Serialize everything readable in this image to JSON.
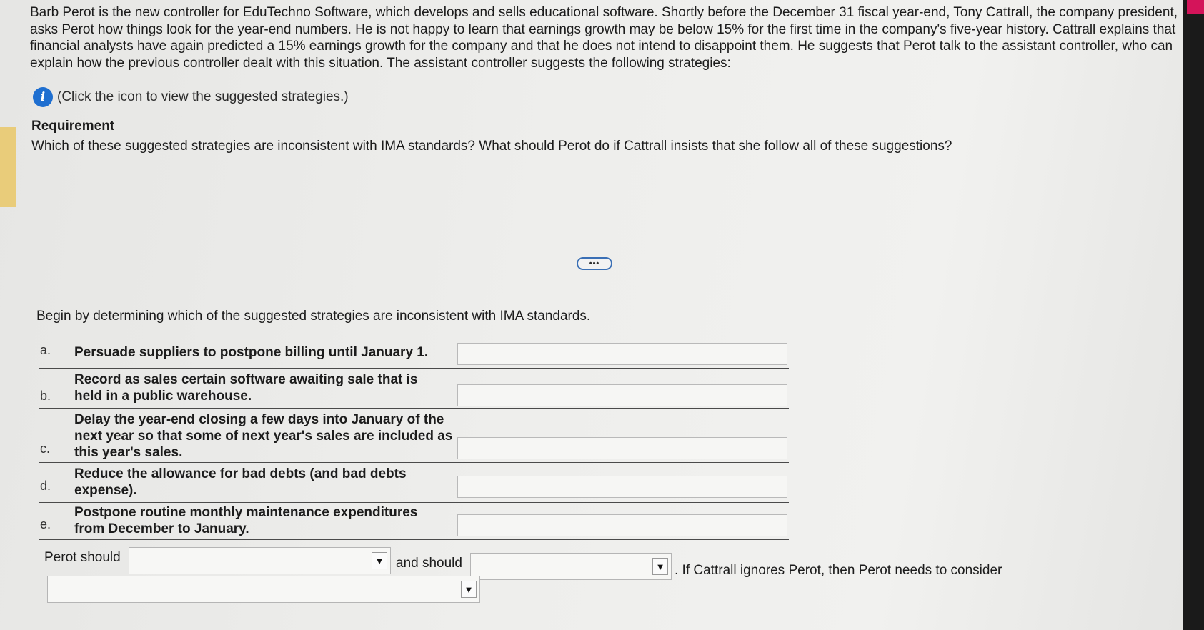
{
  "intro": {
    "paragraph": "Barb Perot is the new controller for EduTechno Software, which develops and sells educational software. Shortly before the December 31 fiscal year-end, Tony Cattrall, the company president, asks Perot how things look for the year-end numbers. He is not happy to learn that earnings growth may be below 15% for the first time in the company's five-year history. Cattrall explains that financial analysts have again predicted a 15% earnings growth for the company and that he does not intend to disappoint them. He suggests that Perot talk to the assistant controller, who can explain how the previous controller dealt with this situation. The assistant controller suggests the following strategies:"
  },
  "info": {
    "icon": "info-icon",
    "icon_glyph": "i",
    "text": "(Click the icon to view the suggested strategies.)"
  },
  "requirement": {
    "title": "Requirement",
    "text": "Which of these suggested strategies are inconsistent with IMA standards? What should Perot do if Cattrall insists that she follow all of these suggestions?"
  },
  "more_button": {
    "label": "•••"
  },
  "task": {
    "instruction": "Begin by determining which of the suggested strategies are inconsistent with IMA standards.",
    "strategies": [
      {
        "letter": "a.",
        "text": "Persuade suppliers to postpone billing until January 1.",
        "answer": ""
      },
      {
        "letter": "b.",
        "text": "Record as sales certain software awaiting sale that is held in a public warehouse.",
        "answer": ""
      },
      {
        "letter": "c.",
        "text": "Delay the year-end closing a few days into January of the next year so that some of next year's sales are included as this year's sales.",
        "answer": ""
      },
      {
        "letter": "d.",
        "text": "Reduce the allowance for bad debts (and bad debts expense).",
        "answer": ""
      },
      {
        "letter": "e.",
        "text": "Postpone routine monthly maintenance expenditures from December to January.",
        "answer": ""
      }
    ]
  },
  "perot": {
    "label_should": "Perot should",
    "label_and_should": "and should",
    "label_if_ignores": ". If Cattrall ignores Perot, then Perot needs to consider",
    "select1_value": "",
    "select2_value": "",
    "select3_value": "",
    "arrow_glyph": "▼"
  },
  "colors": {
    "info_icon": "#1f6fd0",
    "more_button_border": "#3a6fb5",
    "left_accent": "#e9cc7a"
  }
}
